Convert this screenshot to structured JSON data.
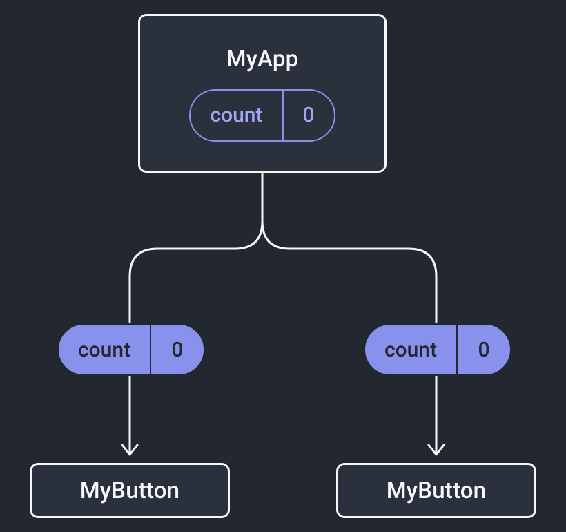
{
  "root": {
    "title": "MyApp",
    "state": {
      "name": "count",
      "value": "0"
    }
  },
  "props": {
    "left": {
      "name": "count",
      "value": "0"
    },
    "right": {
      "name": "count",
      "value": "0"
    }
  },
  "leaves": {
    "left": {
      "title": "MyButton"
    },
    "right": {
      "title": "MyButton"
    }
  }
}
